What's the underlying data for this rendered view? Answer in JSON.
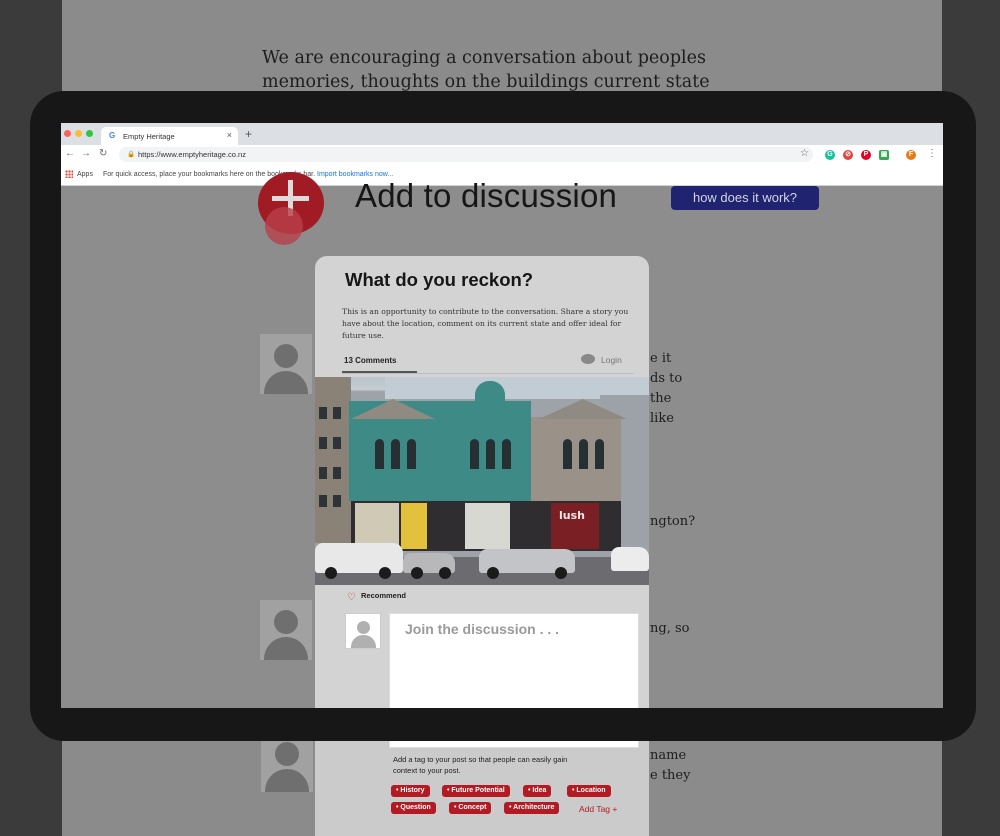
{
  "background_page": {
    "intro_text": "We are encouraging a conversation about peoples memories, thoughts on the buildings current state and potential ideas for"
  },
  "browser": {
    "tab_title": "Empty Heritage",
    "tab_close": "×",
    "new_tab": "+",
    "url": "https://www.emptyheritage.co.nz",
    "bookmarks_apps": "Apps",
    "bookmarks_hint": "For quick access, place your bookmarks here on the bookmarks bar.",
    "bookmarks_import": "Import bookmarks now...",
    "extensions": [
      {
        "icon": "grammarly-icon",
        "color": "#15c39a",
        "glyph": "G"
      },
      {
        "icon": "adblock-icon",
        "color": "#e0443a",
        "glyph": "⊘"
      },
      {
        "icon": "pinterest-icon",
        "color": "#e60023",
        "glyph": "P"
      },
      {
        "icon": "extension-green-icon",
        "color": "#34a853",
        "glyph": "▣"
      },
      {
        "icon": "profile-avatar-icon",
        "color": "#e67c17",
        "glyph": "F"
      }
    ]
  },
  "page": {
    "add_title": "Add to discussion",
    "how_button": "how does it work?",
    "side_fragments": [
      "e it",
      "ds to",
      "the",
      "like",
      "ngton?",
      "ng, so",
      "name",
      "e they"
    ]
  },
  "card": {
    "title": "What do you reckon?",
    "description": "This is an opportunity to contribute to the conversation. Share a story you have about the location, comment on its current state and offer ideal for future use.",
    "comments_tab": "13 Comments",
    "login": "Login",
    "recommend": "Recommend",
    "textarea_placeholder": "Join the discussion . . .",
    "tag_hint": "Add a tag to your post so that people can easily gain context to your post.",
    "tags": [
      "History",
      "Future Potential",
      "Idea",
      "Location",
      "Question",
      "Concept",
      "Architecture"
    ],
    "add_tag": "Add Tag +",
    "shop_sign": "lush"
  }
}
